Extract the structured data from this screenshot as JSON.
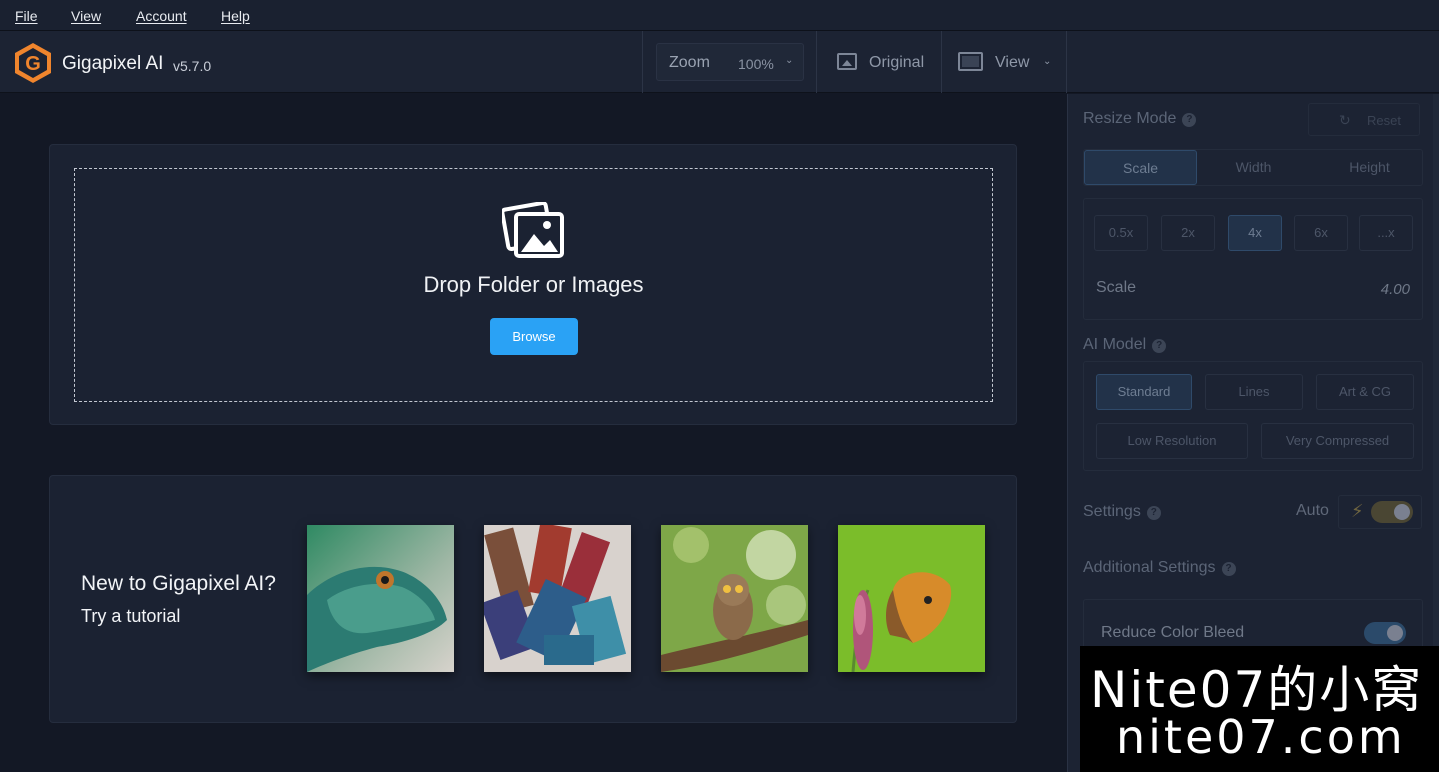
{
  "menu": {
    "file": "File",
    "view": "View",
    "account": "Account",
    "help": "Help"
  },
  "header": {
    "app_name": "Gigapixel AI",
    "version": "v5.7.0",
    "logo_letter": "G",
    "zoom_label": "Zoom",
    "zoom_value": "100%",
    "original_label": "Original",
    "view_label": "View"
  },
  "drop": {
    "text": "Drop Folder or Images",
    "browse": "Browse"
  },
  "tutorial": {
    "title": "New to Gigapixel AI?",
    "subtitle": "Try a tutorial",
    "thumbnails": [
      "lizard",
      "paint-brushes",
      "owl",
      "butterfly"
    ]
  },
  "panel": {
    "resize_mode_title": "Resize Mode",
    "reset_label": "Reset",
    "modes": [
      "Scale",
      "Width",
      "Height"
    ],
    "active_mode": "Scale",
    "scale_chips": [
      "0.5x",
      "2x",
      "4x",
      "6x",
      "...x"
    ],
    "active_scale": "4x",
    "scale_label": "Scale",
    "scale_value": "4.00",
    "ai_model_title": "AI Model",
    "models_row1": [
      "Standard",
      "Lines",
      "Art & CG"
    ],
    "models_row2": [
      "Low Resolution",
      "Very Compressed"
    ],
    "active_model": "Standard",
    "settings_title": "Settings",
    "auto_label": "Auto",
    "additional_title": "Additional Settings",
    "reduce_color_bleed": "Reduce Color Bleed"
  },
  "watermark": {
    "line1": "Nite07的小窝",
    "line2": "nite07.com"
  },
  "colors": {
    "accent": "#2aa2f5",
    "logo_orange": "#f0852d",
    "background": "#131825"
  }
}
